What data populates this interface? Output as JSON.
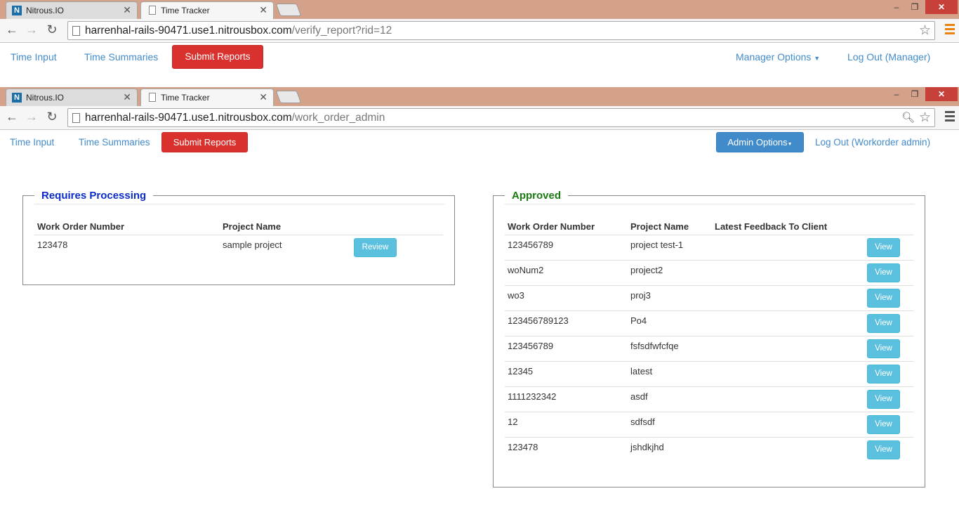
{
  "windows": [
    {
      "tabs": [
        {
          "label": "Nitrous.IO",
          "icon": "nitrous-logo-icon"
        },
        {
          "label": "Time Tracker",
          "icon": "page-icon"
        }
      ],
      "url_host": "harrenhal-rails-90471.use1.nitrousbox.com",
      "url_path": "/verify_report?rid=12",
      "nav": {
        "time_input": "Time Input",
        "time_summaries": "Time Summaries",
        "submit_reports": "Submit Reports",
        "options": "Manager Options",
        "logout": "Log Out (Manager)"
      }
    },
    {
      "tabs": [
        {
          "label": "Nitrous.IO",
          "icon": "nitrous-logo-icon"
        },
        {
          "label": "Time Tracker",
          "icon": "page-icon"
        }
      ],
      "url_host": "harrenhal-rails-90471.use1.nitrousbox.com",
      "url_path": "/work_order_admin",
      "nav": {
        "time_input": "Time Input",
        "time_summaries": "Time Summaries",
        "submit_reports": "Submit Reports",
        "options": "Admin Options",
        "logout": "Log Out (Workorder admin)"
      }
    }
  ],
  "requires_processing": {
    "title": "Requires Processing",
    "title_color": "#0b2cc8",
    "headers": [
      "Work Order Number",
      "Project Name"
    ],
    "rows": [
      {
        "work_order": "123478",
        "project": "sample project",
        "action": "Review"
      }
    ]
  },
  "approved": {
    "title": "Approved",
    "title_color": "#1a7a12",
    "headers": [
      "Work Order Number",
      "Project Name",
      "Latest Feedback To Client"
    ],
    "rows": [
      {
        "work_order": "123456789",
        "project": "project test-1",
        "feedback": "",
        "action": "View"
      },
      {
        "work_order": "woNum2",
        "project": "project2",
        "feedback": "",
        "action": "View"
      },
      {
        "work_order": "wo3",
        "project": "proj3",
        "feedback": "",
        "action": "View"
      },
      {
        "work_order": "123456789123",
        "project": "Po4",
        "feedback": "",
        "action": "View"
      },
      {
        "work_order": "123456789",
        "project": "fsfsdfwfcfqe",
        "feedback": "",
        "action": "View"
      },
      {
        "work_order": "12345",
        "project": "latest",
        "feedback": "",
        "action": "View"
      },
      {
        "work_order": "1111232342",
        "project": "asdf",
        "feedback": "",
        "action": "View"
      },
      {
        "work_order": "12",
        "project": "sdfsdf",
        "feedback": "",
        "action": "View"
      },
      {
        "work_order": "123478",
        "project": "jshdkjhd",
        "feedback": "",
        "action": "View"
      }
    ]
  },
  "colors": {
    "chrome_frame": "#d4a28b",
    "link": "#428bca",
    "submit_red": "#d9312d",
    "admin_blue": "#428bca",
    "info_button": "#5bc0de"
  }
}
